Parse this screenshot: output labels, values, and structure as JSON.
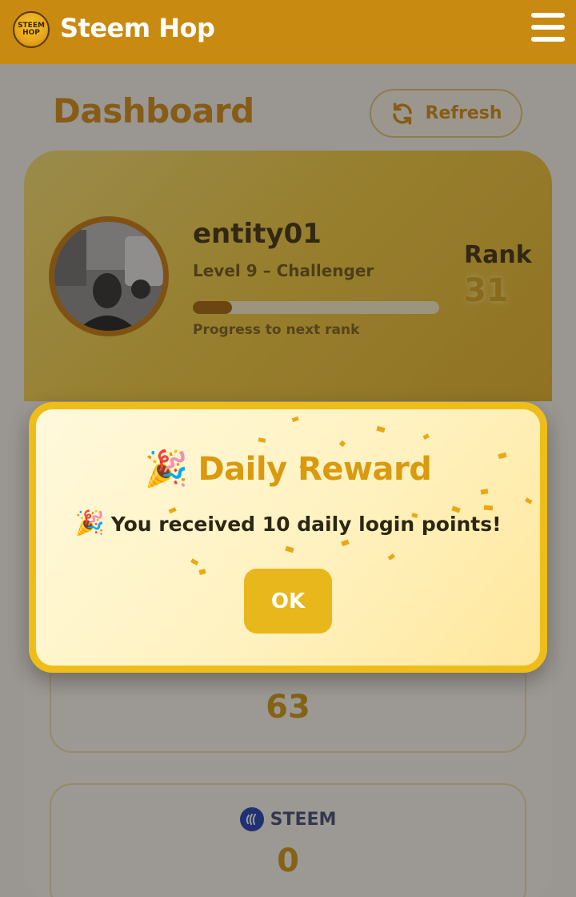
{
  "header": {
    "app_title": "Steem Hop",
    "logo": {
      "line1": "STEEM",
      "line2": "HOP"
    },
    "menu_icon": "hamburger-menu-icon"
  },
  "dashboard": {
    "title": "Dashboard",
    "refresh_label": "Refresh",
    "refresh_icon": "refresh-icon"
  },
  "profile": {
    "username": "entity01",
    "level": "Level 9 – Challenger",
    "progress_label": "Progress to next rank",
    "progress_fraction": 0.16,
    "rank_label": "Rank",
    "rank_value": "31"
  },
  "stats": {
    "points_value": "63",
    "steem_label": "STEEM",
    "steem_value": "0"
  },
  "modal": {
    "title": "Daily Reward",
    "title_emoji": "🎉",
    "message": "You received 10 daily login points!",
    "message_emoji": "🎉",
    "ok_label": "OK"
  },
  "colors": {
    "header": "#c98a12",
    "accent": "#d38a10",
    "modal_border": "#efbd1a",
    "ok_button": "#e8b71b"
  }
}
